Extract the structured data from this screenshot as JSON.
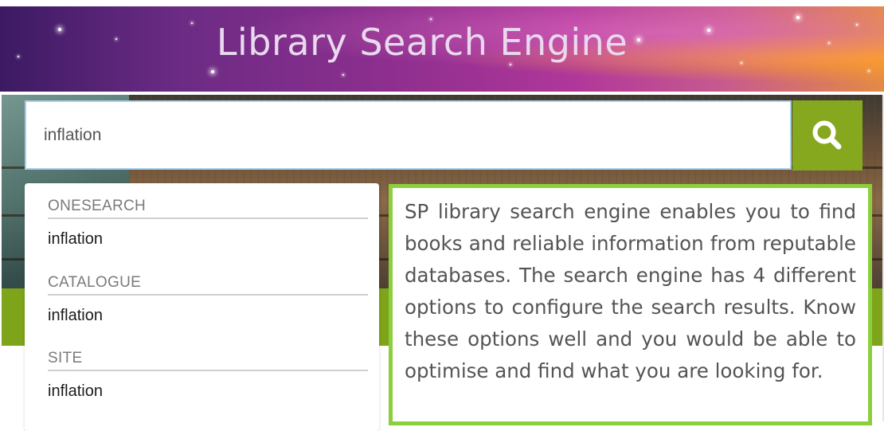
{
  "banner": {
    "title": "Library Search Engine"
  },
  "search": {
    "value": "inflation",
    "button_icon": "search-icon"
  },
  "dropdown": {
    "groups": [
      {
        "header": "ONESEARCH",
        "item": "inflation"
      },
      {
        "header": "CATALOGUE",
        "item": "inflation"
      },
      {
        "header": "SITE",
        "item": "inflation"
      }
    ]
  },
  "callout": {
    "text": "SP library search engine enables you to find books and reliable information from reputable databases.  The search engine has 4 different options to configure the search results.  Know these options well and you would be able to optimise and find what you are looking for."
  },
  "colors": {
    "search_button": "#85a81f",
    "callout_border": "#8ccf3c",
    "band_green": "#7ea419"
  }
}
